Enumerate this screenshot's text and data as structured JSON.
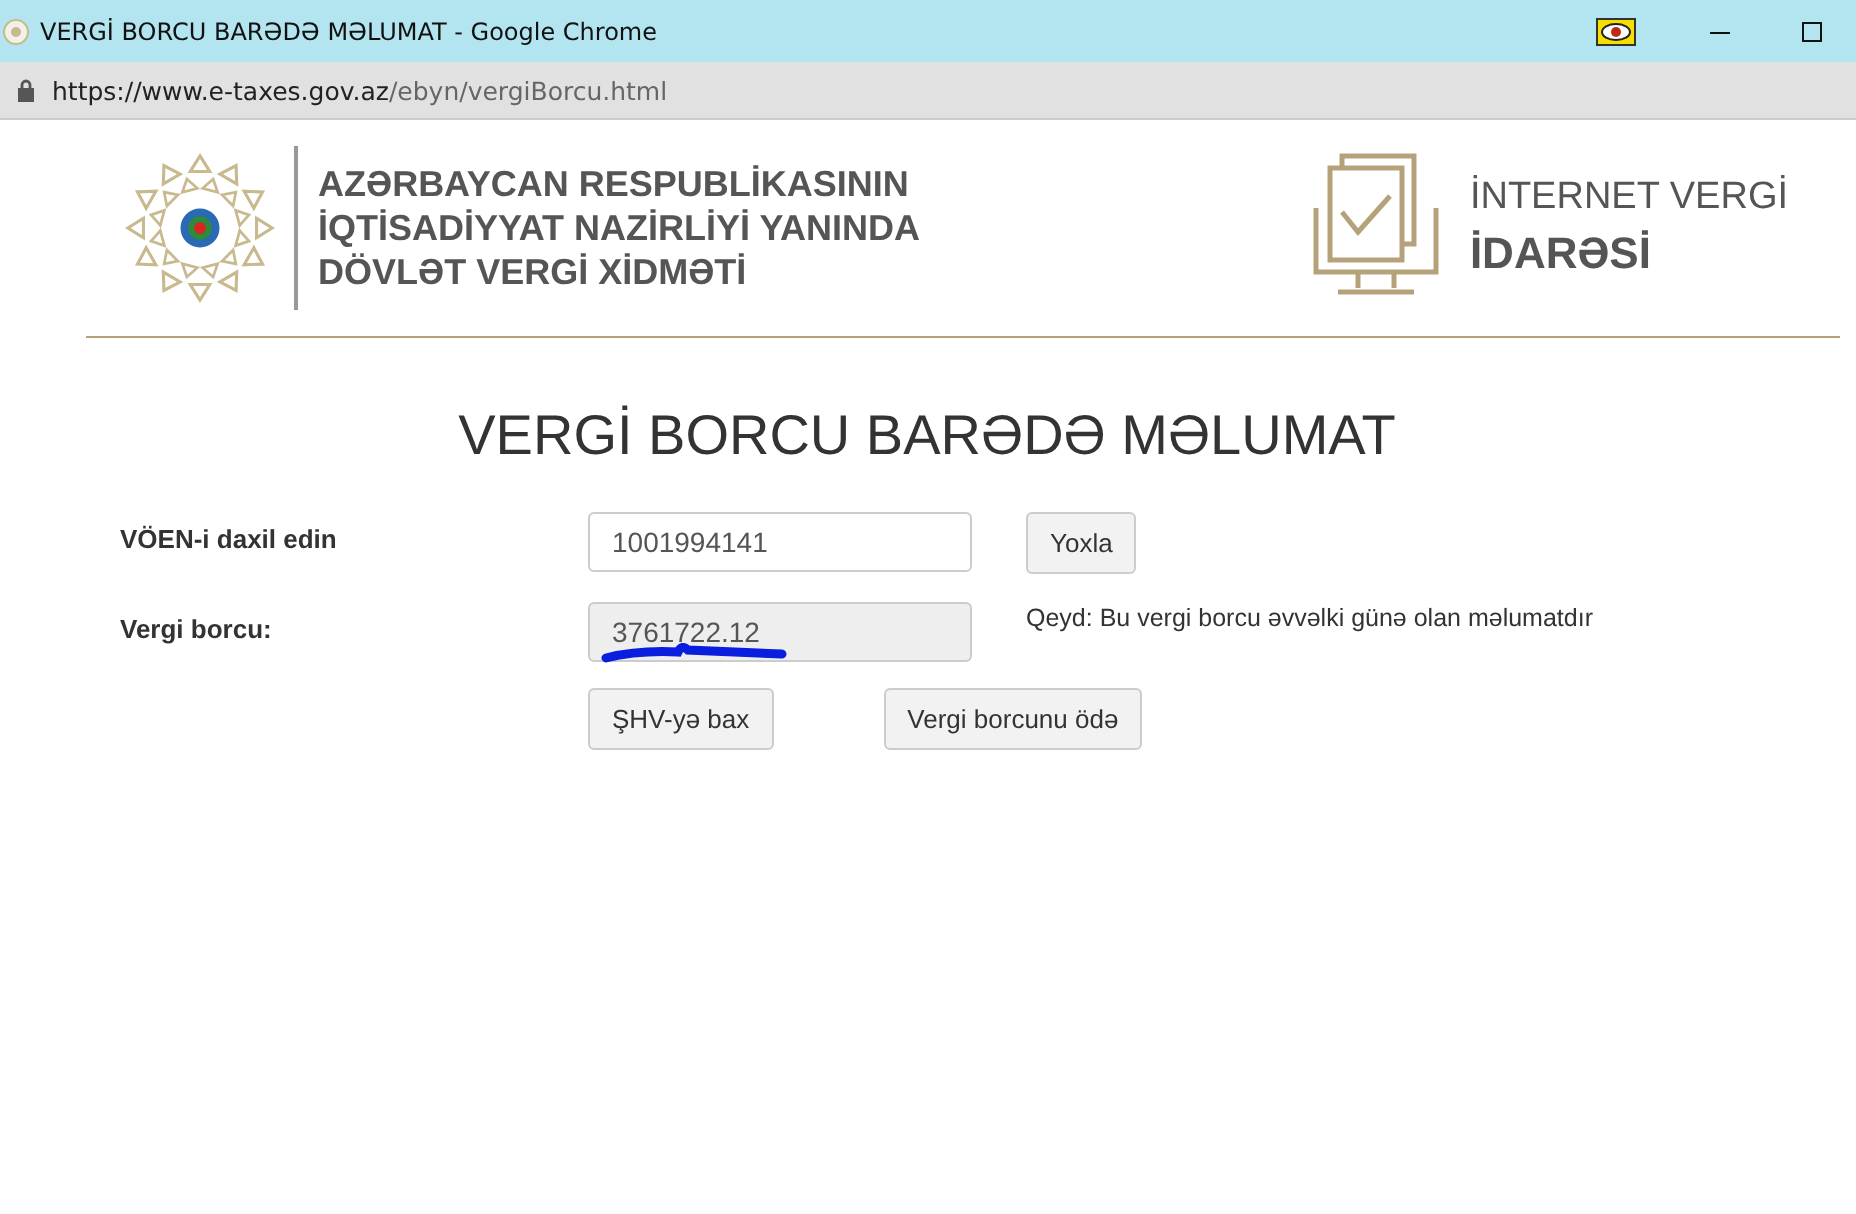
{
  "window": {
    "title": "VERGİ BORCU BARƏDƏ MƏLUMAT - Google Chrome"
  },
  "address_bar": {
    "url_host": "https://www.e-taxes.gov.az",
    "url_path": "/ebyn/vergiBorcu.html"
  },
  "header": {
    "org_lines": [
      "AZƏRBAYCAN RESPUBLİKASININ",
      "İQTİSADİYYAT NAZİRLİYİ YANINDA",
      "DÖVLƏT VERGİ XİDMƏTİ"
    ],
    "service_lines": [
      "İNTERNET VERGİ",
      "İDARƏSİ"
    ]
  },
  "heading": "VERGİ BORCU BARƏDƏ MƏLUMAT",
  "form": {
    "voen_label": "VÖEN-i daxil edin",
    "voen_value": "1001994141",
    "check_button": "Yoxla",
    "debt_label": "Vergi borcu:",
    "debt_value": "3761722.12",
    "note": "Qeyd: Bu vergi borcu əvvəlki günə olan məlumatdır",
    "buttons": [
      "ŞHV-yə bax",
      "Vergi borcunu ödə"
    ]
  }
}
